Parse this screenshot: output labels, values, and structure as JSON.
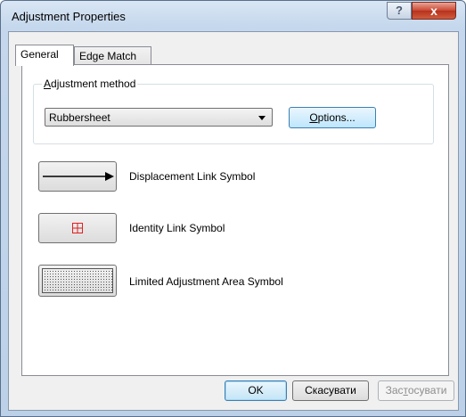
{
  "window": {
    "title": "Adjustment Properties",
    "help_label": "?",
    "close_label": "x"
  },
  "tabs": [
    {
      "label": "General",
      "active": true
    },
    {
      "label": "Edge Match",
      "active": false
    }
  ],
  "adjustment": {
    "group_label_mnemonic": "A",
    "group_label_rest": "djustment method",
    "method_value": "Rubbersheet",
    "options_mnemonic": "O",
    "options_rest": "ptions..."
  },
  "symbols": [
    {
      "label": "Displacement Link Symbol",
      "icon": "arrow-line-icon"
    },
    {
      "label": "Identity Link Symbol",
      "icon": "red-cross-box-icon"
    },
    {
      "label": "Limited Adjustment Area Symbol",
      "icon": "dotted-fill-icon"
    }
  ],
  "buttons": {
    "ok": "OK",
    "cancel": "Скасувати",
    "apply_pre": "Зас",
    "apply_mnemonic": "т",
    "apply_post": "осувати"
  },
  "colors": {
    "identity_symbol": "#e02020",
    "default_button_border": "#3c7fb1"
  }
}
